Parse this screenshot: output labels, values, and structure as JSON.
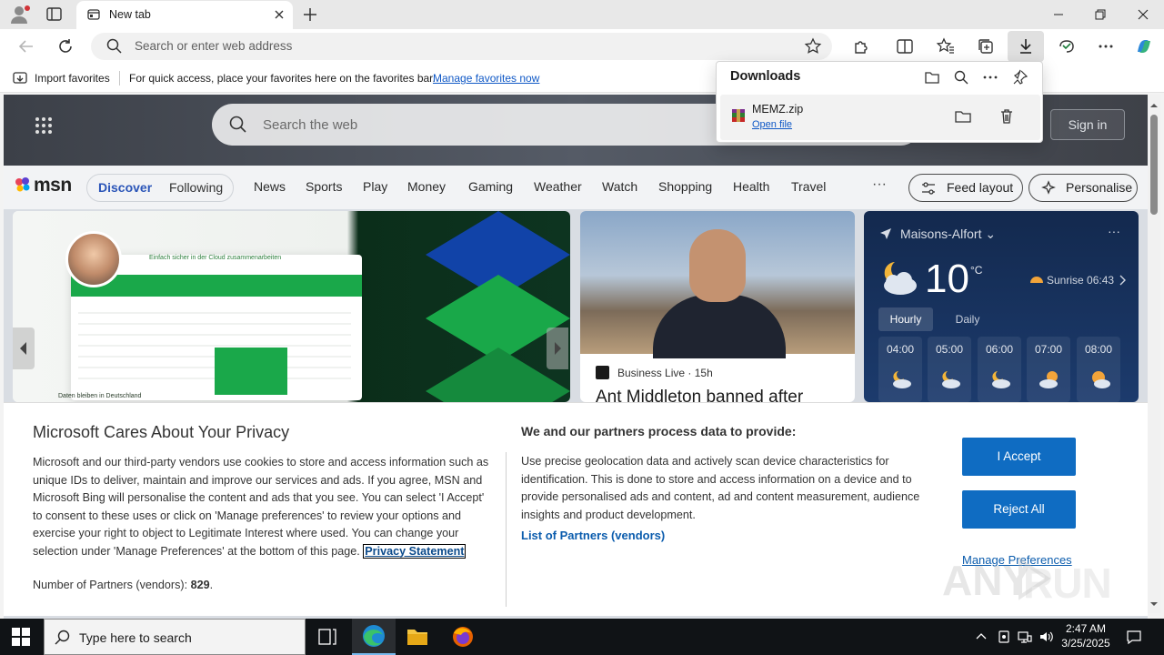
{
  "browser": {
    "tab_title": "New tab",
    "address_placeholder": "Search or enter web address",
    "favorites_bar": {
      "import_label": "Import favorites",
      "hint": "For quick access, place your favorites here on the favorites bar.",
      "manage_link": "Manage favorites now"
    }
  },
  "downloads": {
    "title": "Downloads",
    "item": {
      "file_name": "MEMZ.zip",
      "action": "Open file"
    }
  },
  "msn": {
    "search_placeholder": "Search the web",
    "sign_in": "Sign in",
    "logo_text": "msn",
    "tabs": {
      "discover": "Discover",
      "following": "Following"
    },
    "categories": [
      "News",
      "Sports",
      "Play",
      "Money",
      "Gaming",
      "Weather",
      "Watch",
      "Shopping",
      "Health",
      "Travel"
    ],
    "more": "···",
    "feed_layout": "Feed layout",
    "personalise": "Personalise",
    "promo": {
      "tagline": "Einfach sicher in der Cloud zusammenarbeiten",
      "footer": "Daten bleiben in Deutschland"
    },
    "news": {
      "source": "Business Live",
      "age": "15h",
      "headline": "Ant Middleton banned after"
    },
    "weather": {
      "location": "Maisons-Alfort",
      "temperature": "10",
      "unit": "°C",
      "sunrise": "Sunrise 06:43",
      "tab_hourly": "Hourly",
      "tab_daily": "Daily",
      "hours": [
        "04:00",
        "05:00",
        "06:00",
        "07:00",
        "08:00"
      ]
    }
  },
  "privacy": {
    "title": "Microsoft Cares About Your Privacy",
    "body": "Microsoft and our third-party vendors use cookies to store and access information such as unique IDs to deliver, maintain and improve our services and ads. If you agree, MSN and Microsoft Bing will personalise the content and ads that you see. You can select 'I Accept' to consent to these uses or click on 'Manage preferences' to review your options and exercise your right to object to Legitimate Interest where used.  You can change your selection under 'Manage Preferences' at the bottom of this page.",
    "privacy_link": "Privacy Statement",
    "partners_label": "Number of Partners (vendors):",
    "partners_count": "829",
    "partners_suffix": ".",
    "subtitle": "We and our partners process data to provide:",
    "purpose": "Use precise geolocation data and actively scan device characteristics for identification. This is done to store and access information on a device and to provide personalised ads and content, ad and content measurement, audience insights and product development.",
    "list_partners": "List of Partners (vendors)",
    "accept": "I Accept",
    "reject": "Reject All",
    "manage": "Manage Preferences"
  },
  "watermark": {
    "text": "RUN"
  },
  "taskbar": {
    "search_placeholder": "Type here to search",
    "time": "2:47 AM",
    "date": "3/25/2025"
  },
  "colors": {
    "accent_blue": "#0f6cc2",
    "link_blue": "#0f58c6",
    "msn_blue": "#2b55b8",
    "taskbar": "#101316"
  }
}
